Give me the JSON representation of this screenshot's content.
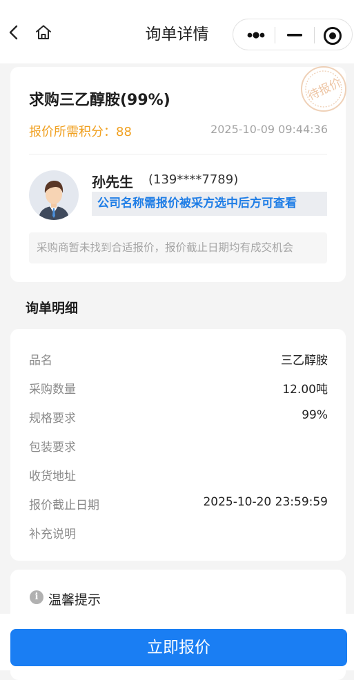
{
  "nav": {
    "title": "询单详情"
  },
  "summary": {
    "product_title": "求购三乙醇胺(99%)",
    "points_label": "报价所需积分：",
    "points_value": "88",
    "datetime": "2025-10-09 09:44:36",
    "stamp_text": "待报价",
    "contact_name": "孙先生",
    "contact_phone": "(139****7789)",
    "company_hint": "公司名称需报价被采方选中后方可查看",
    "notice": "采购商暂未找到合适报价，报价截止日期均有成交机会"
  },
  "details": {
    "section_title": "询单明细",
    "rows": [
      {
        "label": "品名",
        "value": "三乙醇胺"
      },
      {
        "label": "采购数量",
        "value": "12.00吨"
      },
      {
        "label": "规格要求",
        "value": "99%"
      },
      {
        "label": "包装要求",
        "value": ""
      },
      {
        "label": "收货地址",
        "value": ""
      },
      {
        "label": "报价截止日期",
        "value": "2025-10-20 23:59:59"
      },
      {
        "label": "补充说明",
        "value": ""
      }
    ]
  },
  "tip": {
    "icon": "info-icon",
    "title": "温馨提示"
  },
  "action": {
    "quote_button": "立即报价"
  },
  "colors": {
    "accent": "#1a7ef3",
    "points": "#f0a020",
    "company_hint": "#1e7de6"
  }
}
